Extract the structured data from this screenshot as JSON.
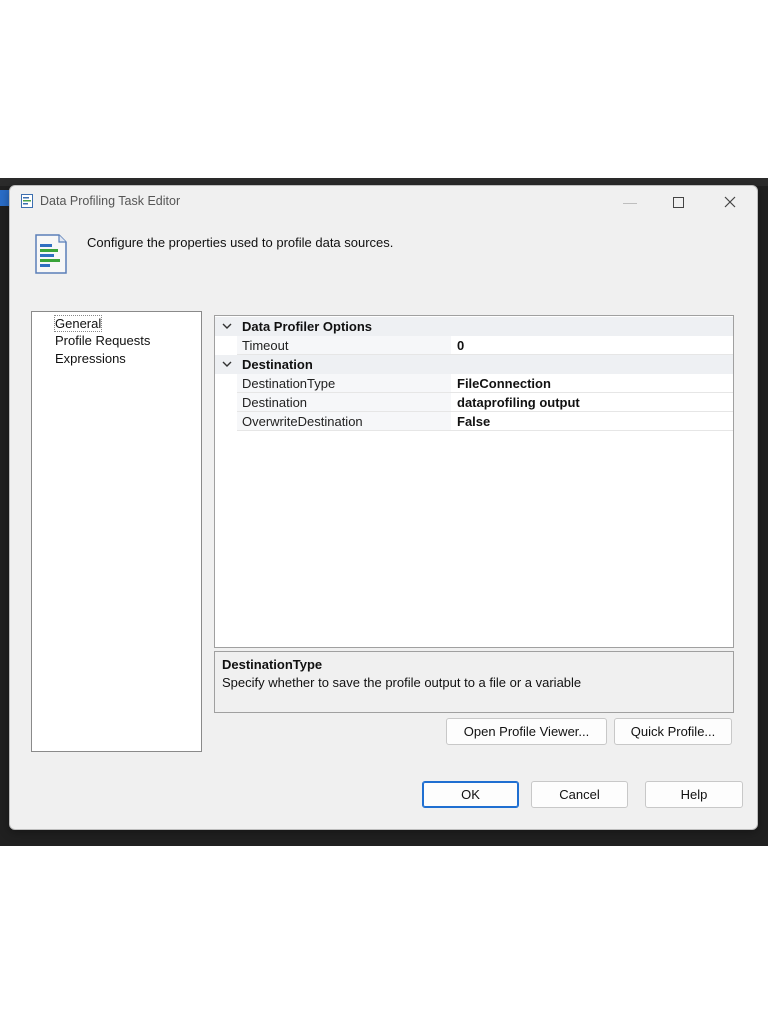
{
  "window": {
    "title": "Data Profiling Task Editor",
    "header_description": "Configure the properties used to profile data sources."
  },
  "nav": {
    "items": [
      {
        "label": "General",
        "selected": true
      },
      {
        "label": "Profile Requests",
        "selected": false
      },
      {
        "label": "Expressions",
        "selected": false
      }
    ]
  },
  "property_grid": {
    "categories": [
      {
        "label": "Data Profiler Options",
        "properties": [
          {
            "name": "Timeout",
            "value": "0"
          }
        ]
      },
      {
        "label": "Destination",
        "properties": [
          {
            "name": "DestinationType",
            "value": "FileConnection"
          },
          {
            "name": "Destination",
            "value": "dataprofiling output"
          },
          {
            "name": "OverwriteDestination",
            "value": "False"
          }
        ]
      }
    ]
  },
  "description": {
    "title": "DestinationType",
    "text": "Specify whether to save the profile output to a file or a variable"
  },
  "buttons": {
    "open_profile_viewer": "Open Profile Viewer...",
    "quick_profile": "Quick Profile...",
    "ok": "OK",
    "cancel": "Cancel",
    "help": "Help"
  },
  "icons": {
    "window_icon": "document-icon",
    "header_icon": "profile-document-icon",
    "minimize": "minimize-icon",
    "maximize": "maximize-icon",
    "close": "close-icon",
    "expand": "chevron-down-icon"
  },
  "colors": {
    "accent": "#1f6fd1",
    "dialog_bg": "#f0f0f0",
    "backdrop": "#202020"
  }
}
